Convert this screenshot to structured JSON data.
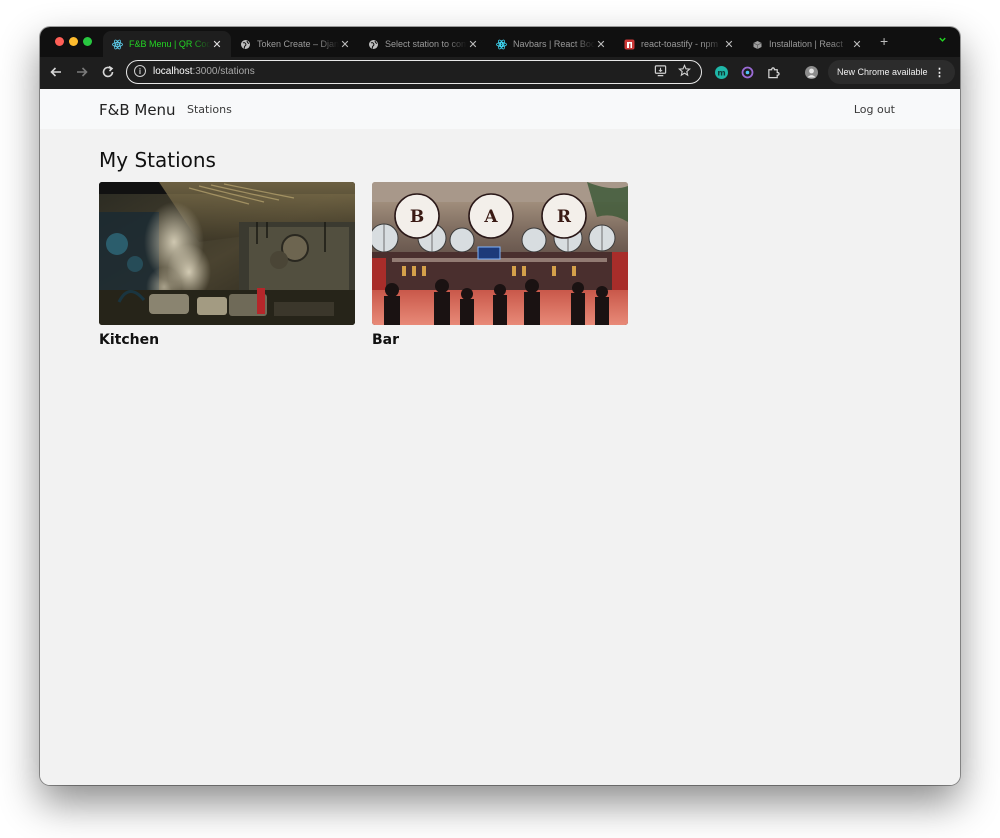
{
  "browser": {
    "tabs": [
      {
        "title": "F&B Menu | QR Code",
        "icon": "react-icon",
        "active": true
      },
      {
        "title": "Token Create – Django",
        "icon": "globe-icon",
        "active": false
      },
      {
        "title": "Select station to configure",
        "icon": "globe-icon",
        "active": false
      },
      {
        "title": "Navbars | React Bootstrap",
        "icon": "react-bootstrap-icon",
        "active": false
      },
      {
        "title": "react-toastify - npm",
        "icon": "npm-icon",
        "active": false
      },
      {
        "title": "Installation | React",
        "icon": "docs-icon",
        "active": false
      }
    ],
    "new_tab_symbol": "+",
    "close_symbol": "✕",
    "url_host": "localhost",
    "url_path": ":3000/stations",
    "update_button": "New Chrome available",
    "accent_color": "#23d523"
  },
  "navbar": {
    "brand": "F&B Menu",
    "links": [
      "Stations"
    ],
    "logout": "Log out"
  },
  "page": {
    "title": "My Stations"
  },
  "stations": [
    {
      "name": "Kitchen",
      "image": "kitchen-photo"
    },
    {
      "name": "Bar",
      "image": "bar-photo",
      "sign_letters": [
        "B",
        "A",
        "R"
      ]
    }
  ]
}
